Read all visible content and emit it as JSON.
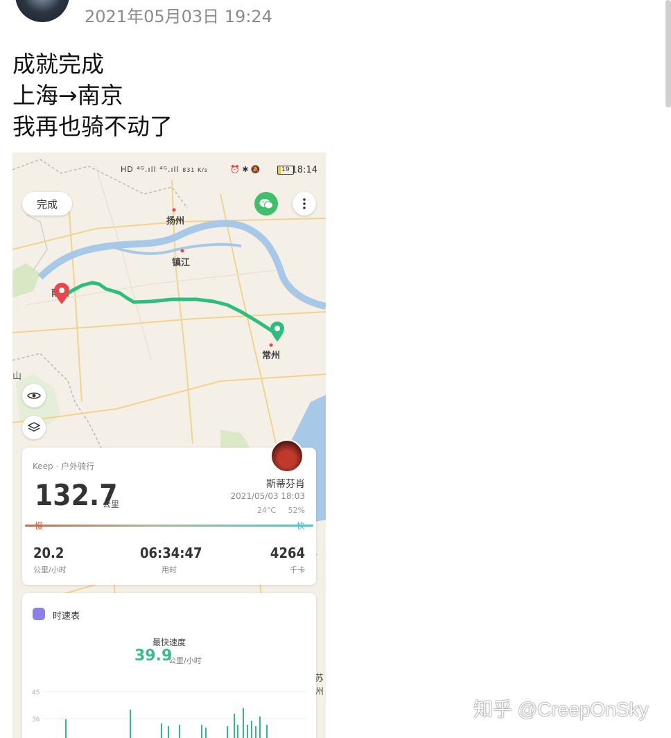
{
  "post": {
    "timestamp": "2021年05月03日 19:24",
    "lines": [
      "成就完成",
      "上海→南京",
      "我再也骑不动了"
    ]
  },
  "watermark": "知乎 @CreepOnSky",
  "phone": {
    "status_bar": {
      "left_icons": "HD ⁴ᴳ.ıll ⁴ᴳ.ıll",
      "speed": "831 K/s",
      "right_icons": "⏰ ✱ 🔕",
      "battery": "19",
      "time": "18:14"
    },
    "done_label": "完成",
    "map": {
      "cities": [
        {
          "name": "扬州"
        },
        {
          "name": "镇江"
        },
        {
          "name": "南京"
        },
        {
          "name": "常州"
        },
        {
          "name": "山"
        },
        {
          "name": "苏州"
        }
      ],
      "route_color": "#2dbd7e",
      "start_color": "#2dbd7e",
      "end_color": "#e8474c"
    },
    "summary": {
      "source": "Keep · 户外骑行",
      "distance": "132.7",
      "distance_unit": "公里",
      "user_name": "斯蒂芬肖",
      "date": "2021/05/03 18:03",
      "temperature": "24°C",
      "humidity": "52%",
      "slow_label": "慢",
      "fast_label": "快",
      "stats": [
        {
          "value": "20.2",
          "label": "公里/小时"
        },
        {
          "value": "06:34:47",
          "label": "用时"
        },
        {
          "value": "4264",
          "label": "千卡"
        }
      ]
    },
    "speed_card": {
      "title": "时速表",
      "max_label": "最快速度",
      "max_value": "39.9",
      "max_unit": "公里/小时",
      "axis_ticks": [
        "45",
        "36"
      ],
      "bar_color": "#2dbd7e"
    }
  }
}
